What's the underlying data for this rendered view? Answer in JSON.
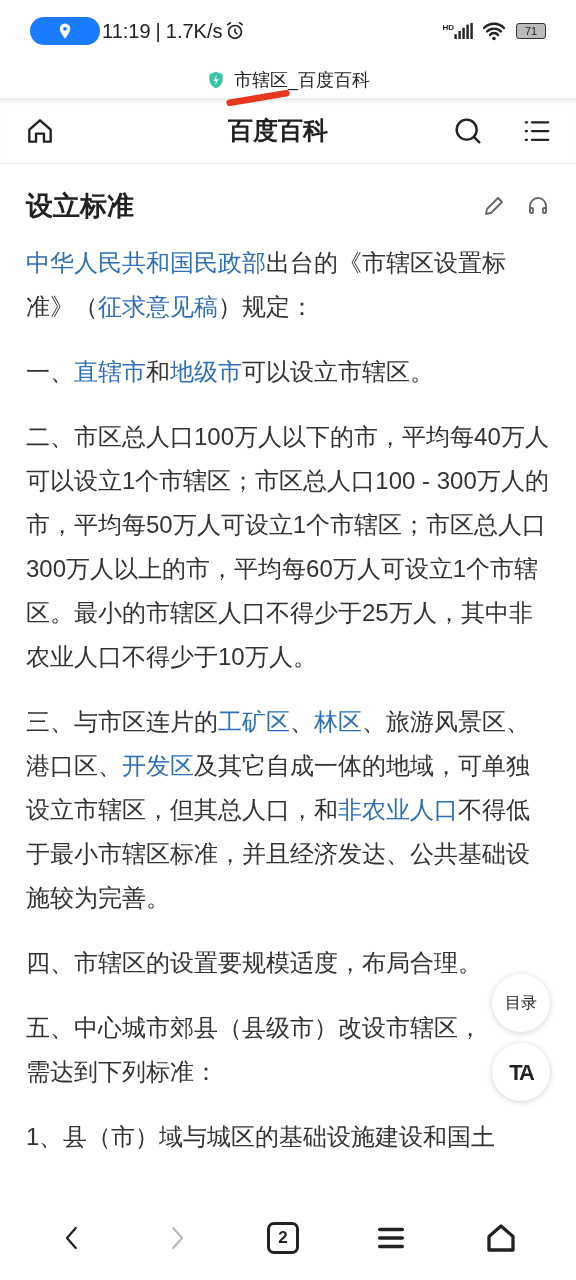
{
  "status_bar": {
    "time": "11:19",
    "speed": "1.7K/s",
    "separator": "|",
    "battery": "71",
    "network": "HD"
  },
  "page_title": "市辖区_百度百科",
  "header": {
    "title": "百度百科"
  },
  "section": {
    "heading": "设立标准"
  },
  "paragraphs": [
    [
      {
        "text": "中华人民共和国民政部",
        "link": true
      },
      {
        "text": "出台的《市辖区设置标准》（",
        "link": false
      },
      {
        "text": "征求意见稿",
        "link": true
      },
      {
        "text": "）规定：",
        "link": false
      }
    ],
    [
      {
        "text": "一、",
        "link": false
      },
      {
        "text": "直辖市",
        "link": true
      },
      {
        "text": "和",
        "link": false
      },
      {
        "text": "地级市",
        "link": true
      },
      {
        "text": "可以设立市辖区。",
        "link": false
      }
    ],
    [
      {
        "text": "二、市区总人口100万人以下的市，平均每40万人可以设立1个市辖区；市区总人口100 - 300万人的市，平均每50万人可设立1个市辖区；市区总人口300万人以上的市，平均每60万人可设立1个市辖区。最小的市辖区人口不得少于25万人，其中非农业人口不得少于10万人。",
        "link": false
      }
    ],
    [
      {
        "text": "三、与市区连片的",
        "link": false
      },
      {
        "text": "工矿区",
        "link": true
      },
      {
        "text": "、",
        "link": false
      },
      {
        "text": "林区",
        "link": true
      },
      {
        "text": "、旅游风景区、港口区、",
        "link": false
      },
      {
        "text": "开发区",
        "link": true
      },
      {
        "text": "及其它自成一体的地域，可单独设立市辖区，但其总人口，和",
        "link": false
      },
      {
        "text": "非农业人口",
        "link": true
      },
      {
        "text": "不得低于最小市辖区标准，并且经济发达、公共基础设施较为完善。",
        "link": false
      }
    ],
    [
      {
        "text": "四、市辖区的设置要规模适度，布局合理。",
        "link": false
      }
    ],
    [
      {
        "text": "五、中心城市郊县（县级市）改设市辖区，需达到下列标准：",
        "link": false
      }
    ],
    [
      {
        "text": "1、县（市）域与城区的基础设施建设和国土",
        "link": false
      }
    ]
  ],
  "floating": {
    "toc": "目录",
    "font": "TA"
  },
  "bottom_nav": {
    "tabs_count": "2",
    "forward_disabled": true
  }
}
